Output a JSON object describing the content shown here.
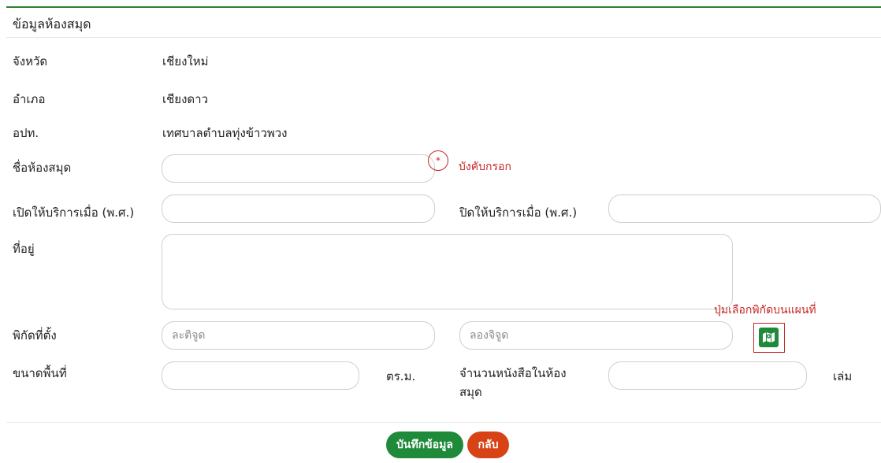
{
  "card": {
    "title": "ข้อมูลห้องสมุด"
  },
  "fields": {
    "province": {
      "label": "จังหวัด",
      "value": "เชียงใหม่"
    },
    "district": {
      "label": "อำเภอ",
      "value": "เชียงดาว"
    },
    "lao": {
      "label": "อปท.",
      "value": "เทศบาลตำบลทุ่งข้าวพวง"
    },
    "library_name": {
      "label": "ชื่อห้องสมุด",
      "value": "",
      "required_mark": "*",
      "required_text": "บังคับกรอก"
    },
    "open_year": {
      "label": "เปิดให้บริการเมื่อ (พ.ศ.)",
      "value": ""
    },
    "close_year": {
      "label": "ปิดให้บริการเมื่อ (พ.ศ.)",
      "value": ""
    },
    "address": {
      "label": "ที่อยู่",
      "value": ""
    },
    "coordinates": {
      "label": "พิกัดที่ตั้ง",
      "latitude_placeholder": "ละติจูด",
      "longitude_placeholder": "ลองจิจูด",
      "map_note": "ปุ่มเลือกพิกัดบนแผนที่",
      "map_icon": "map-marker-icon"
    },
    "area": {
      "label": "ขนาดพื้นที่",
      "value": "",
      "unit": "ตร.ม."
    },
    "book_count": {
      "label": "จำนวนหนังสือในห้อง สมุด",
      "value": "",
      "unit": "เล่ม"
    }
  },
  "actions": {
    "save_label": "บันทึกข้อมูล",
    "back_label": "กลับ"
  },
  "colors": {
    "primary": "#1e8a3a",
    "danger": "#d84315",
    "required": "#c62828"
  }
}
